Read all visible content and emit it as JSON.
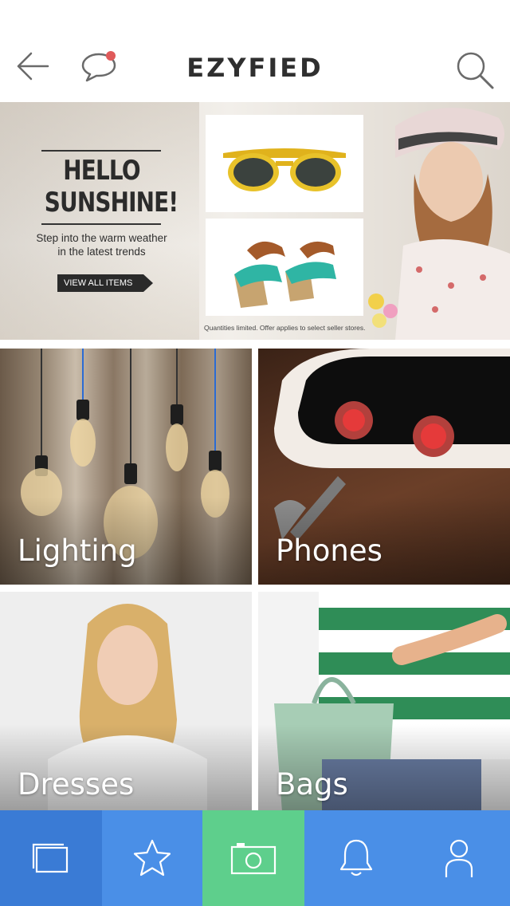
{
  "header": {
    "brand": "EZYFIED"
  },
  "banner": {
    "headline_line1": "HELLO",
    "headline_line2": "SUNSHINE!",
    "subtitle_line1": "Step into the warm weather",
    "subtitle_line2": "in the latest trends",
    "cta": "VIEW ALL ITEMS",
    "fine_print": "Quantities limited. Offer applies to select seller stores."
  },
  "categories": [
    {
      "label": "Lighting"
    },
    {
      "label": "Phones"
    },
    {
      "label": "Dresses"
    },
    {
      "label": "Bags"
    }
  ],
  "bottom_nav": {
    "items": [
      {
        "icon": "feed-icon",
        "color": "#3a7bd5"
      },
      {
        "icon": "star-icon",
        "color": "#4a8fe7"
      },
      {
        "icon": "camera-icon",
        "color": "#5ecf8c"
      },
      {
        "icon": "bell-icon",
        "color": "#4a8fe7"
      },
      {
        "icon": "user-icon",
        "color": "#4a8fe7"
      }
    ]
  },
  "colors": {
    "notification_dot": "#e05a5a",
    "brand_text": "#2f2f2f"
  }
}
